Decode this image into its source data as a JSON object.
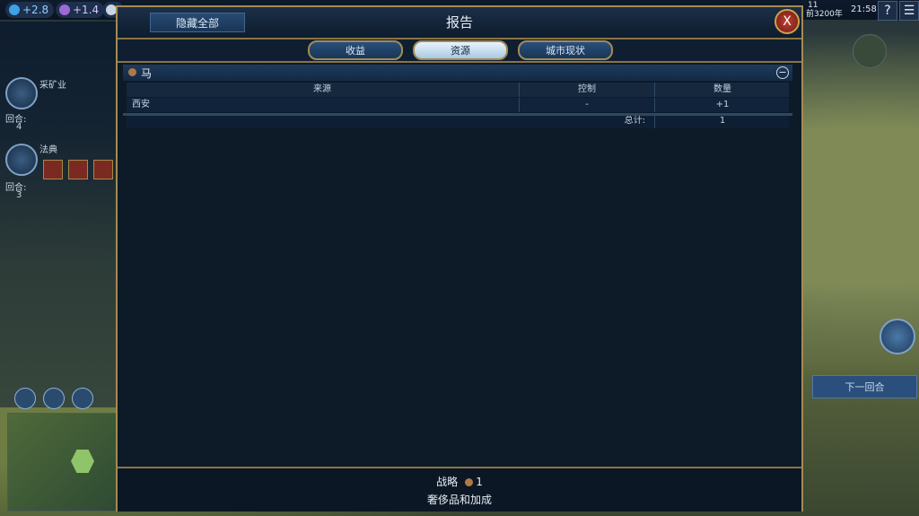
{
  "topbar": {
    "science": "+2.8",
    "faith": "+1.4",
    "turn_line1": "11",
    "turn_line2": "前3200年",
    "clock": "21:58",
    "help": "?",
    "menu": "☰"
  },
  "left_panel": {
    "item1_label": "采矿业",
    "item1_turns_label": "回合:",
    "item1_turns": "4",
    "item2_label": "法典",
    "item2_turns_label": "回合:",
    "item2_turns": "3"
  },
  "next_turn": "下一回合",
  "report": {
    "hide_all": "隐藏全部",
    "title": "报告",
    "close": "X",
    "tabs": [
      {
        "label": "收益",
        "active": false
      },
      {
        "label": "资源",
        "active": true
      },
      {
        "label": "城市现状",
        "active": false
      }
    ],
    "section": {
      "name": "马",
      "collapse": "−",
      "headers": [
        "来源",
        "控制",
        "数量"
      ],
      "rows": [
        {
          "source": "西安",
          "control": "-",
          "amount": "+1"
        }
      ],
      "total_label": "总计:",
      "total_value": "1"
    },
    "footer": {
      "strategic_label": "战略",
      "strategic_count": "1",
      "luxury_label": "奢侈品和加成"
    }
  },
  "colors": {
    "gold_border": "#a48b52",
    "panel_bg": "#0d1a27",
    "tab_active": "#e9f3fb"
  }
}
